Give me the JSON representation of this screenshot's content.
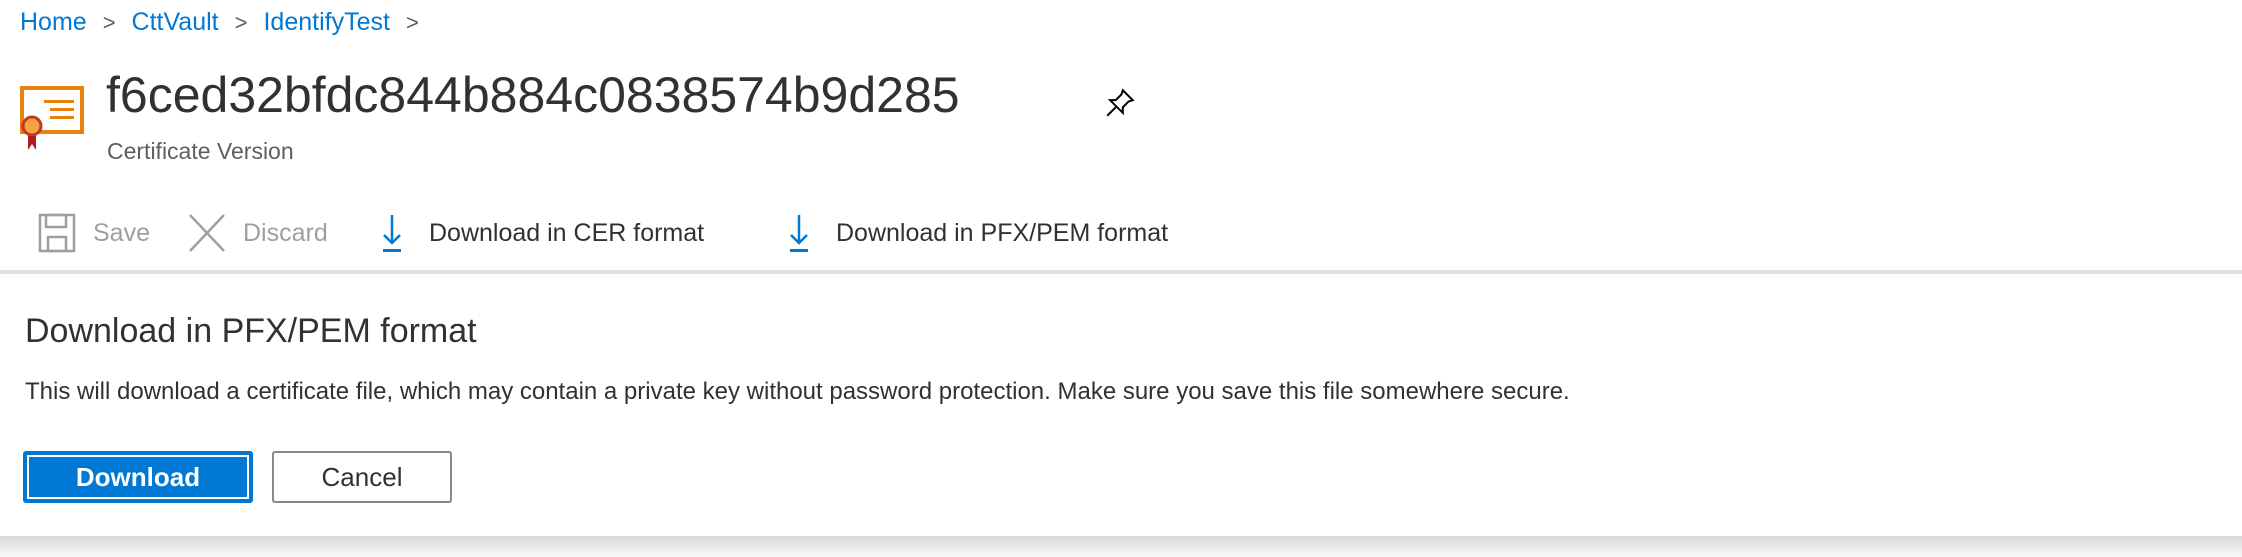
{
  "breadcrumb": [
    {
      "label": "Home"
    },
    {
      "label": "CttVault"
    },
    {
      "label": "IdentifyTest"
    }
  ],
  "breadcrumb_separator": ">",
  "header": {
    "title": "f6ced32bfdc844b884c0838574b9d285",
    "subtitle": "Certificate Version",
    "icon": "certificate-icon",
    "pin_icon": "pin-icon"
  },
  "toolbar": {
    "save": "Save",
    "discard": "Discard",
    "download_cer": "Download in CER format",
    "download_pfx": "Download in PFX/PEM format"
  },
  "panel": {
    "heading": "Download in PFX/PEM format",
    "message": "This will download a certificate file, which may contain a private key without password protection. Make sure you save this file somewhere secure.",
    "download_label": "Download",
    "cancel_label": "Cancel"
  },
  "colors": {
    "accent": "#0078d4",
    "icon_orange": "#e8820c",
    "ribbon_red": "#b3171e"
  }
}
